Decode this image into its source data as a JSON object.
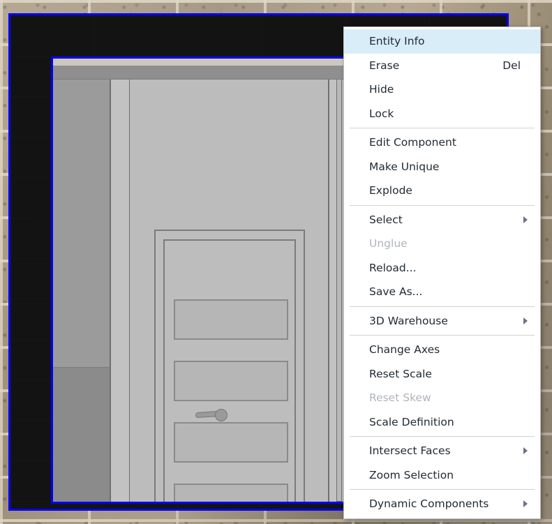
{
  "scene": {
    "description": "SketchUp 3D viewport showing a selected door component in a wall, over a brick-wall desktop background",
    "selection_outline_color": "#0000ff",
    "background_wall_color": "#a39480",
    "viewport_background_color": "#131313",
    "model_face_color": "#bcbcbc",
    "model_edge_color": "#6f6f6f",
    "objects": {
      "outer_selection": "outer-selected-entity",
      "inner_selection": "wall-and-door-component",
      "door": "paneled-door",
      "door_panel_count": 4,
      "door_handle": "lever-handle"
    }
  },
  "context_menu": {
    "highlight_color": "#d9edf9",
    "background_color": "#ffffff",
    "border_color": "#c0c0c0",
    "text_color": "#1f2933",
    "disabled_text_color": "#b0b5ba",
    "groups": [
      {
        "items": [
          {
            "label": "Entity Info",
            "accel": "",
            "submenu": false,
            "disabled": false,
            "highlighted": true
          },
          {
            "label": "Erase",
            "accel": "Del",
            "submenu": false,
            "disabled": false,
            "highlighted": false
          },
          {
            "label": "Hide",
            "accel": "",
            "submenu": false,
            "disabled": false,
            "highlighted": false
          },
          {
            "label": "Lock",
            "accel": "",
            "submenu": false,
            "disabled": false,
            "highlighted": false
          }
        ]
      },
      {
        "items": [
          {
            "label": "Edit Component",
            "accel": "",
            "submenu": false,
            "disabled": false,
            "highlighted": false
          },
          {
            "label": "Make Unique",
            "accel": "",
            "submenu": false,
            "disabled": false,
            "highlighted": false
          },
          {
            "label": "Explode",
            "accel": "",
            "submenu": false,
            "disabled": false,
            "highlighted": false
          }
        ]
      },
      {
        "items": [
          {
            "label": "Select",
            "accel": "",
            "submenu": true,
            "disabled": false,
            "highlighted": false
          },
          {
            "label": "Unglue",
            "accel": "",
            "submenu": false,
            "disabled": true,
            "highlighted": false
          },
          {
            "label": "Reload...",
            "accel": "",
            "submenu": false,
            "disabled": false,
            "highlighted": false
          },
          {
            "label": "Save As...",
            "accel": "",
            "submenu": false,
            "disabled": false,
            "highlighted": false
          }
        ]
      },
      {
        "items": [
          {
            "label": "3D Warehouse",
            "accel": "",
            "submenu": true,
            "disabled": false,
            "highlighted": false
          }
        ]
      },
      {
        "items": [
          {
            "label": "Change Axes",
            "accel": "",
            "submenu": false,
            "disabled": false,
            "highlighted": false
          },
          {
            "label": "Reset Scale",
            "accel": "",
            "submenu": false,
            "disabled": false,
            "highlighted": false
          },
          {
            "label": "Reset Skew",
            "accel": "",
            "submenu": false,
            "disabled": true,
            "highlighted": false
          },
          {
            "label": "Scale Definition",
            "accel": "",
            "submenu": false,
            "disabled": false,
            "highlighted": false
          }
        ]
      },
      {
        "items": [
          {
            "label": "Intersect Faces",
            "accel": "",
            "submenu": true,
            "disabled": false,
            "highlighted": false
          },
          {
            "label": "Zoom Selection",
            "accel": "",
            "submenu": false,
            "disabled": false,
            "highlighted": false
          }
        ]
      },
      {
        "items": [
          {
            "label": "Dynamic Components",
            "accel": "",
            "submenu": true,
            "disabled": false,
            "highlighted": false
          }
        ]
      }
    ]
  }
}
